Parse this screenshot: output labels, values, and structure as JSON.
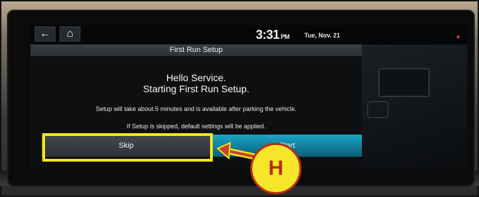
{
  "screen": {
    "time": "3:31",
    "ampm": "PM",
    "date": "Tue, Nov. 21"
  },
  "dialog": {
    "title": "First Run Setup",
    "greeting_line1": "Hello Service.",
    "greeting_line2": "Starting First Run Setup.",
    "info_line1": "Setup will take about 5 minutes and is available after parking the vehicle.",
    "info_line2": "If Setup is skipped, default settings will be applied.",
    "skip_label": "Skip",
    "start_label": "Start"
  },
  "annotation": {
    "callout_letter": "H",
    "highlight_color": "#f4e81a",
    "arrow_color": "#c9412b"
  },
  "icons": {
    "back": "back-arrow-icon",
    "home": "home-icon",
    "status": "status-icon"
  }
}
